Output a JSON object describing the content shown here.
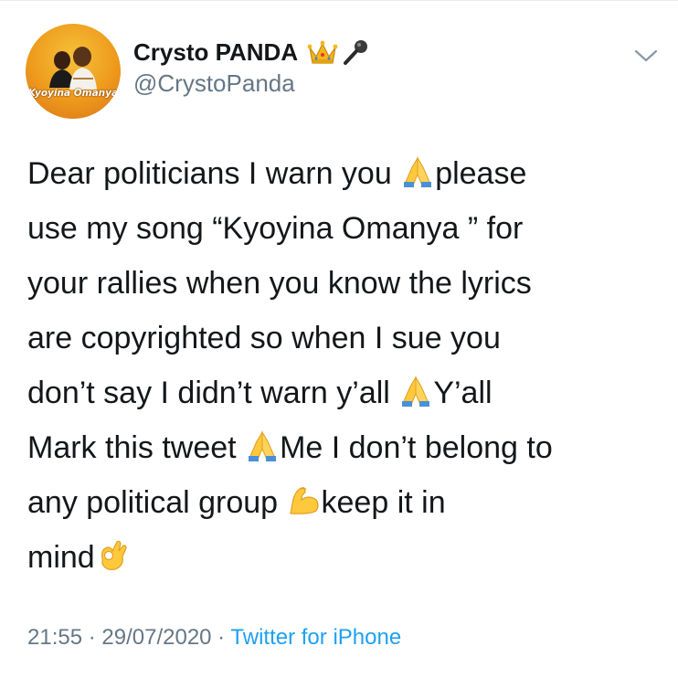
{
  "tweet": {
    "author": {
      "display_name": "Crysto PANDA",
      "name_emojis": [
        "crown-emoji",
        "microphone-emoji"
      ],
      "handle": "@CrystoPanda",
      "avatar_text": "Kyoyina Omanya"
    },
    "menu_icon": "chevron-down-icon",
    "body": {
      "line1": "Dear politicians I warn you ",
      "line1b": "please",
      "line2": "use my song “Kyoyina Omanya ” for",
      "line3": "your rallies when you know the lyrics",
      "line4": "are copyrighted so when I sue you",
      "line5": "don’t say I didn’t warn y’all ",
      "line5b": "Y’all",
      "line6": "Mark this tweet ",
      "line6b": "Me I don’t belong to",
      "line7": "any political group ",
      "line7b": "keep it in",
      "line8": "mind",
      "emojis": [
        "folded-hands-emoji",
        "flexed-biceps-emoji",
        "ok-hand-emoji"
      ]
    },
    "meta": {
      "time": "21:55",
      "separator": " · ",
      "date": "29/07/2020",
      "source": "Twitter for iPhone"
    },
    "colors": {
      "text": "#14171a",
      "secondary": "#657786",
      "link": "#1da1f2",
      "emoji_yellow": "#ffc83d"
    }
  }
}
